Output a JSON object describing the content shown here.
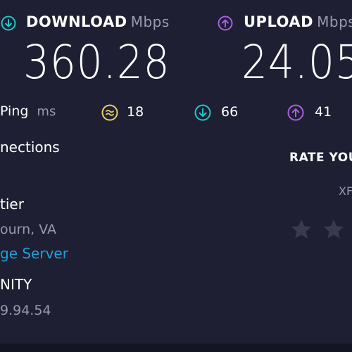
{
  "download": {
    "label": "DOWNLOAD",
    "unit": "Mbps",
    "value": "360.28",
    "color": "#1fc7c7"
  },
  "upload": {
    "label": "UPLOAD",
    "unit": "Mbps",
    "value": "24.05",
    "color": "#a860e0"
  },
  "ping": {
    "label": "Ping",
    "unit": "ms",
    "idle": "18",
    "download": "66",
    "upload": "41",
    "idle_color": "#e6d06a"
  },
  "connections_label": "nections",
  "server": {
    "isp_name": "tier",
    "location": "ourn, VA",
    "change_link": "ge Server"
  },
  "client": {
    "label": "NITY",
    "ip": "9.94.54"
  },
  "rate": {
    "label": "RATE YOU",
    "subtext": "XF",
    "star_color": "#3a3a4e"
  }
}
